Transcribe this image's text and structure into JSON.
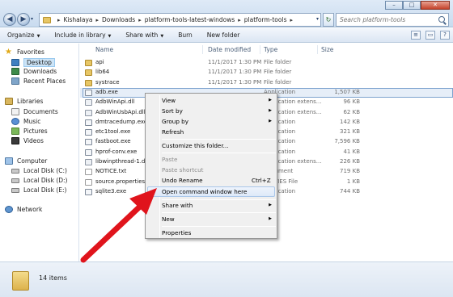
{
  "window": {
    "caption_buttons": [
      "–",
      "□",
      "✕"
    ]
  },
  "address_bar": {
    "crumbs": [
      "Kishalaya",
      "Downloads",
      "platform-tools-latest-windows",
      "platform-tools"
    ],
    "separator": "▸",
    "dropdown": "▾"
  },
  "search": {
    "placeholder": "Search platform-tools"
  },
  "toolbar": {
    "items": [
      {
        "label": "Organize",
        "caret": "▼"
      },
      {
        "label": "Include in library",
        "caret": "▼"
      },
      {
        "label": "Share with",
        "caret": "▼"
      },
      {
        "label": "Burn",
        "caret": ""
      },
      {
        "label": "New folder",
        "caret": ""
      }
    ]
  },
  "nav_pane": {
    "favorites": {
      "label": "Favorites",
      "items": [
        "Desktop",
        "Downloads",
        "Recent Places"
      ]
    },
    "libraries": {
      "label": "Libraries",
      "items": [
        "Documents",
        "Music",
        "Pictures",
        "Videos"
      ]
    },
    "computer": {
      "label": "Computer",
      "items": [
        "Local Disk (C:)",
        "Local Disk (D:)",
        "Local Disk (E:)"
      ]
    },
    "network": {
      "label": "Network"
    }
  },
  "columns": {
    "name": "Name",
    "date": "Date modified",
    "type": "Type",
    "size": "Size"
  },
  "files": [
    {
      "name": "api",
      "date": "11/1/2017 1:30 PM",
      "type": "File folder",
      "size": "",
      "kind": "folder"
    },
    {
      "name": "lib64",
      "date": "11/1/2017 1:30 PM",
      "type": "File folder",
      "size": "",
      "kind": "folder"
    },
    {
      "name": "systrace",
      "date": "11/1/2017 1:30 PM",
      "type": "File folder",
      "size": "",
      "kind": "folder"
    },
    {
      "name": "adb.exe",
      "date": "",
      "type": "Application",
      "size": "1,507 KB",
      "kind": "exe"
    },
    {
      "name": "AdbWinApi.dll",
      "date": "",
      "type": "Application extens...",
      "size": "96 KB",
      "kind": "dll"
    },
    {
      "name": "AdbWinUsbApi.dll",
      "date": "",
      "type": "Application extens...",
      "size": "62 KB",
      "kind": "dll"
    },
    {
      "name": "dmtracedump.exe",
      "date": "",
      "type": "Application",
      "size": "142 KB",
      "kind": "exe"
    },
    {
      "name": "etc1tool.exe",
      "date": "",
      "type": "Application",
      "size": "321 KB",
      "kind": "exe"
    },
    {
      "name": "fastboot.exe",
      "date": "",
      "type": "Application",
      "size": "7,596 KB",
      "kind": "exe"
    },
    {
      "name": "hprof-conv.exe",
      "date": "",
      "type": "Application",
      "size": "41 KB",
      "kind": "exe"
    },
    {
      "name": "libwinpthread-1.dll",
      "date": "",
      "type": "Application extens...",
      "size": "226 KB",
      "kind": "dll"
    },
    {
      "name": "NOTICE.txt",
      "date": "",
      "type": "Document",
      "size": "719 KB",
      "kind": "file"
    },
    {
      "name": "source.properties",
      "date": "",
      "type": "PERTIES File",
      "size": "1 KB",
      "kind": "file"
    },
    {
      "name": "sqlite3.exe",
      "date": "",
      "type": "Application",
      "size": "744 KB",
      "kind": "exe"
    }
  ],
  "status": {
    "count": "14 items"
  },
  "context_menu": {
    "items": [
      {
        "label": "View",
        "submenu": true
      },
      {
        "label": "Sort by",
        "submenu": true
      },
      {
        "label": "Group by",
        "submenu": true
      },
      {
        "label": "Refresh"
      },
      {
        "label": "Customize this folder..."
      },
      {
        "label": "Paste",
        "disabled": true
      },
      {
        "label": "Paste shortcut",
        "disabled": true
      },
      {
        "label": "Undo Rename",
        "shortcut": "Ctrl+Z"
      },
      {
        "label": "Open command window here",
        "highlighted": true
      },
      {
        "label": "Share with",
        "submenu": true
      },
      {
        "label": "New",
        "submenu": true
      },
      {
        "label": "Properties"
      }
    ],
    "submenu_glyph": "▶"
  },
  "annotation": {
    "arrow_color": "#e0141c"
  }
}
